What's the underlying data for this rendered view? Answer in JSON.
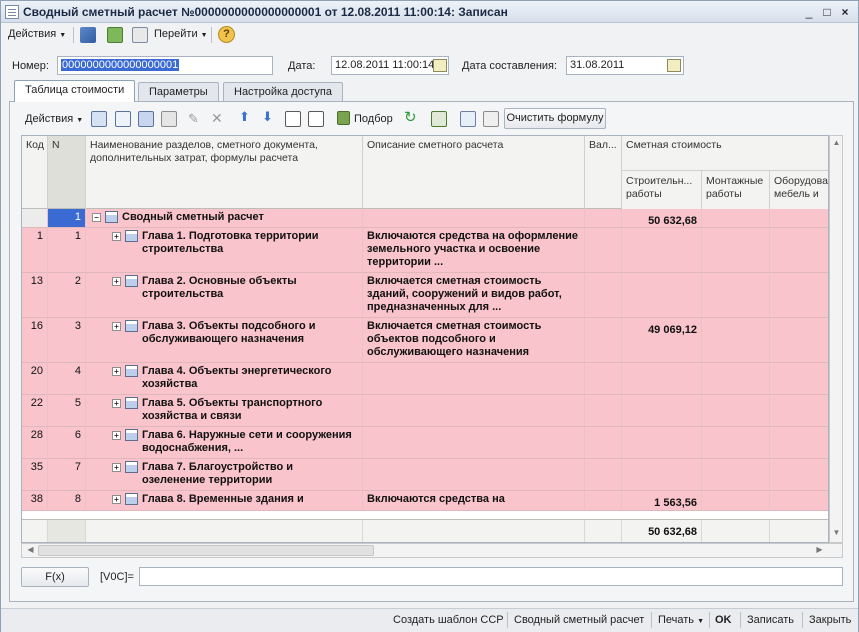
{
  "window": {
    "title": "Сводный сметный расчет №0000000000000000001 от 12.08.2011 11:00:14: Записан",
    "btn_min": "_",
    "btn_max": "□",
    "btn_close": "×"
  },
  "toolbar": {
    "actions_label": "Действия",
    "goto_label": "Перейти",
    "help_label": "?"
  },
  "form": {
    "number_label": "Номер:",
    "number_value": "0000000000000000001",
    "date_label": "Дата:",
    "date_value": "12.08.2011 11:00:14",
    "compose_date_label": "Дата составления:",
    "compose_date_value": "31.08.2011"
  },
  "tabs": [
    {
      "label": "Таблица стоимости"
    },
    {
      "label": "Параметры"
    },
    {
      "label": "Настройка доступа"
    }
  ],
  "grid_toolbar": {
    "actions_label": "Действия",
    "pick_label": "Подбор",
    "clear_formula_label": "Очистить формулу"
  },
  "table": {
    "headers": {
      "kod": "Код",
      "n": "N",
      "name": "Наименование разделов, сметного документа, дополнительных затрат, формулы расчета",
      "desc": "Описание сметного расчета",
      "val": "Вал...",
      "cost": "Сметная стоимость",
      "cost_build": "Строительн... работы",
      "cost_mount": "Монтажные работы",
      "cost_equip": "Оборудова... мебель и"
    },
    "rows": [
      {
        "kod": "",
        "n": "1",
        "name": "Сводный сметный расчет",
        "desc": "",
        "build": "50 632,68",
        "root": true
      },
      {
        "kod": "1",
        "n": "1",
        "name": "Глава 1. Подготовка территории строительства",
        "desc": "Включаются средства на оформление земельного участка и освоение территории ...",
        "build": ""
      },
      {
        "kod": "13",
        "n": "2",
        "name": "Глава 2. Основные объекты строительства",
        "desc": "Включается сметная стоимость зданий, сооружений и видов работ, предназначенных для ...",
        "build": ""
      },
      {
        "kod": "16",
        "n": "3",
        "name": "Глава 3. Объекты подсобного и обслуживающего назначения",
        "desc": "Включается сметная стоимость объектов подсобного и обслуживающего назначения",
        "build": "49 069,12"
      },
      {
        "kod": "20",
        "n": "4",
        "name": "Глава 4. Объекты энергетического хозяйства",
        "desc": "",
        "build": ""
      },
      {
        "kod": "22",
        "n": "5",
        "name": "Глава 5. Объекты транспортного хозяйства и связи",
        "desc": "",
        "build": ""
      },
      {
        "kod": "28",
        "n": "6",
        "name": "Глава 6. Наружные сети и сооружения водоснабжения, ...",
        "desc": "",
        "build": ""
      },
      {
        "kod": "35",
        "n": "7",
        "name": "Глава 7. Благоустройство и озеленение территории",
        "desc": "",
        "build": ""
      },
      {
        "kod": "38",
        "n": "8",
        "name": "Глава 8. Временные здания и",
        "desc": "Включаются средства на",
        "build": "1 563,56"
      }
    ],
    "total": "50 632,68"
  },
  "formula": {
    "fx_label": "F(x)",
    "expr_label": "[V0C]=",
    "expr_value": ""
  },
  "bottom": {
    "template_label": "Создать шаблон ССР",
    "summary_label": "Сводный сметный расчет",
    "print_label": "Печать",
    "ok_label": "OK",
    "save_label": "Записать",
    "close_label": "Закрыть"
  },
  "colors": {
    "row_pink": "#f9c4cb",
    "selection": "#3a6ad2"
  }
}
